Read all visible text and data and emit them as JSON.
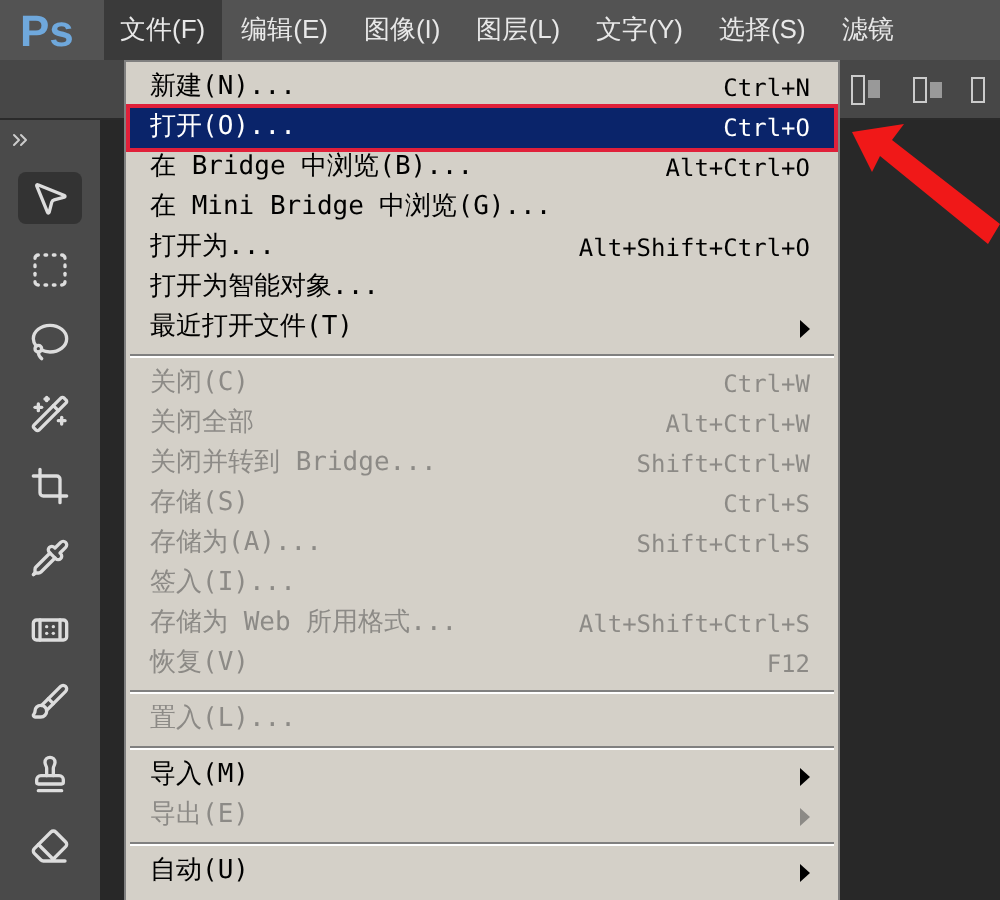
{
  "app_logo": "Ps",
  "menu_bar": [
    {
      "label": "文件(F)",
      "selected": true
    },
    {
      "label": "编辑(E)",
      "selected": false
    },
    {
      "label": "图像(I)",
      "selected": false
    },
    {
      "label": "图层(L)",
      "selected": false
    },
    {
      "label": "文字(Y)",
      "selected": false
    },
    {
      "label": "选择(S)",
      "selected": false
    },
    {
      "label": "滤镜",
      "selected": false
    }
  ],
  "menu": [
    {
      "kind": "item",
      "label": "新建(N)...",
      "shortcut": "Ctrl+N",
      "disabled": false,
      "submenu": false,
      "selected": false
    },
    {
      "kind": "item",
      "label": "打开(O)...",
      "shortcut": "Ctrl+O",
      "disabled": false,
      "submenu": false,
      "selected": true
    },
    {
      "kind": "item",
      "label": "在 Bridge 中浏览(B)...",
      "shortcut": "Alt+Ctrl+O",
      "disabled": false,
      "submenu": false,
      "selected": false
    },
    {
      "kind": "item",
      "label": "在 Mini Bridge 中浏览(G)...",
      "disabled": false,
      "submenu": false,
      "selected": false
    },
    {
      "kind": "item",
      "label": "打开为...",
      "shortcut": "Alt+Shift+Ctrl+O",
      "disabled": false,
      "submenu": false,
      "selected": false
    },
    {
      "kind": "item",
      "label": "打开为智能对象...",
      "disabled": false,
      "submenu": false,
      "selected": false
    },
    {
      "kind": "item",
      "label": "最近打开文件(T)",
      "disabled": false,
      "submenu": true,
      "selected": false
    },
    {
      "kind": "separator"
    },
    {
      "kind": "item",
      "label": "关闭(C)",
      "shortcut": "Ctrl+W",
      "disabled": true,
      "submenu": false,
      "selected": false
    },
    {
      "kind": "item",
      "label": "关闭全部",
      "shortcut": "Alt+Ctrl+W",
      "disabled": true,
      "submenu": false,
      "selected": false
    },
    {
      "kind": "item",
      "label": "关闭并转到 Bridge...",
      "shortcut": "Shift+Ctrl+W",
      "disabled": true,
      "submenu": false,
      "selected": false
    },
    {
      "kind": "item",
      "label": "存储(S)",
      "shortcut": "Ctrl+S",
      "disabled": true,
      "submenu": false,
      "selected": false
    },
    {
      "kind": "item",
      "label": "存储为(A)...",
      "shortcut": "Shift+Ctrl+S",
      "disabled": true,
      "submenu": false,
      "selected": false
    },
    {
      "kind": "item",
      "label": "签入(I)...",
      "disabled": true,
      "submenu": false,
      "selected": false
    },
    {
      "kind": "item",
      "label": "存储为 Web 所用格式...",
      "shortcut": "Alt+Shift+Ctrl+S",
      "disabled": true,
      "submenu": false,
      "selected": false
    },
    {
      "kind": "item",
      "label": "恢复(V)",
      "shortcut": "F12",
      "disabled": true,
      "submenu": false,
      "selected": false
    },
    {
      "kind": "separator"
    },
    {
      "kind": "item",
      "label": "置入(L)...",
      "disabled": true,
      "submenu": false,
      "selected": false
    },
    {
      "kind": "separator"
    },
    {
      "kind": "item",
      "label": "导入(M)",
      "disabled": false,
      "submenu": true,
      "selected": false
    },
    {
      "kind": "item",
      "label": "导出(E)",
      "disabled": true,
      "submenu": true,
      "selected": false
    },
    {
      "kind": "separator"
    },
    {
      "kind": "item",
      "label": "自动(U)",
      "disabled": false,
      "submenu": true,
      "selected": false
    }
  ]
}
